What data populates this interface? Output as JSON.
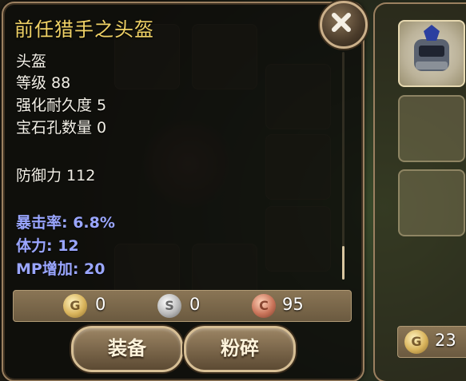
{
  "item": {
    "title": "前任猎手之头盔",
    "type": "头盔",
    "level": "等级 88",
    "durability": "强化耐久度 5",
    "sockets": "宝石孔数量 0",
    "defense": "防御力 112",
    "bonuses": [
      "暴击率: 6.8%",
      "体力: 12",
      "MP增加: 20"
    ]
  },
  "price": {
    "gold": "0",
    "silver": "0",
    "copper": "95"
  },
  "coin_symbols": {
    "gold": "G",
    "silver": "S",
    "copper": "C"
  },
  "buttons": {
    "equip": "装备",
    "smash": "粉碎"
  },
  "side": {
    "gold_amount": "23"
  },
  "colors": {
    "title": "#f0d266",
    "bonus_text": "#9aa6ff",
    "panel_border": "#9b8060"
  }
}
